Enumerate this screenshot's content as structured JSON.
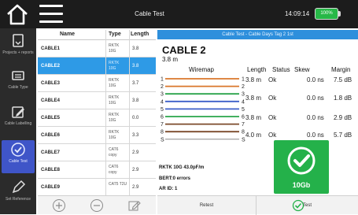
{
  "topbar": {
    "title": "Cable Test",
    "time": "14:09:14",
    "battery": "100%"
  },
  "sidebar": {
    "items": [
      {
        "label": "Projects + reports",
        "icon": "projects-icon"
      },
      {
        "label": "Cable Type",
        "icon": "cable-type-icon"
      },
      {
        "label": "Cable Labelling",
        "icon": "edit-icon"
      },
      {
        "label": "Cable Test",
        "icon": "check-icon"
      },
      {
        "label": "Set Reference",
        "icon": "pen-icon"
      }
    ]
  },
  "list": {
    "headers": {
      "name": "Name",
      "type": "Type",
      "length": "Length"
    },
    "rows": [
      {
        "name": "CABLE1",
        "type": "RKTK 10G",
        "length": "3.8",
        "selected": false
      },
      {
        "name": "CABLE2",
        "type": "RKTK 10G",
        "length": "3.8",
        "selected": true
      },
      {
        "name": "CABLE3",
        "type": "RKTK 10G",
        "length": "3.7",
        "selected": false
      },
      {
        "name": "CABLE4",
        "type": "RKTK 10G",
        "length": "3.8",
        "selected": false
      },
      {
        "name": "CABLE5",
        "type": "RKTK 10G",
        "length": "0.0",
        "selected": false
      },
      {
        "name": "CABLE6",
        "type": "RKTK 10G",
        "length": "3.3",
        "selected": false
      },
      {
        "name": "CABLE7",
        "type": "CAT6 copy",
        "length": "2.9",
        "selected": false
      },
      {
        "name": "CABLE8",
        "type": "CAT6 copy",
        "length": "2.9",
        "selected": false
      },
      {
        "name": "CABLE9",
        "type": "CAT5 T2U",
        "length": "2.9",
        "selected": false
      }
    ]
  },
  "detail": {
    "header": "Cable Test - Cable Days Tag 2 1st",
    "cable_name": "CABLE 2",
    "cable_length": "3.8 m",
    "wiremap_label": "Wiremap",
    "col_length": "Length",
    "col_status": "Status",
    "col_skew": "Skew",
    "col_margin": "Margin",
    "pairs": [
      {
        "length": "3.8 m",
        "status": "Ok",
        "skew": "0.0 ns",
        "margin": "7.5 dB"
      },
      {
        "length": "3.8 m",
        "status": "Ok",
        "skew": "0.0 ns",
        "margin": "1.8 dB"
      },
      {
        "length": "3.8 m",
        "status": "Ok",
        "skew": "0.0 ns",
        "margin": "2.9 dB"
      },
      {
        "length": "4.0 m",
        "status": "Ok",
        "skew": "0.0 ns",
        "margin": "5.7 dB"
      }
    ],
    "wire_numbers": [
      "1",
      "2",
      "3",
      "4",
      "5",
      "6",
      "7",
      "8",
      "S"
    ],
    "info_line1": "RKTK 10G  43.0pF/m",
    "info_line2": "BERT:0 errors",
    "info_line3": "AR ID: 1",
    "pass_speed": "10Gb"
  },
  "bottom": {
    "retest": "Retest",
    "test": "Test"
  },
  "colors": {
    "accent_blue": "#2e9ae6",
    "pass_green": "#24b14a"
  }
}
